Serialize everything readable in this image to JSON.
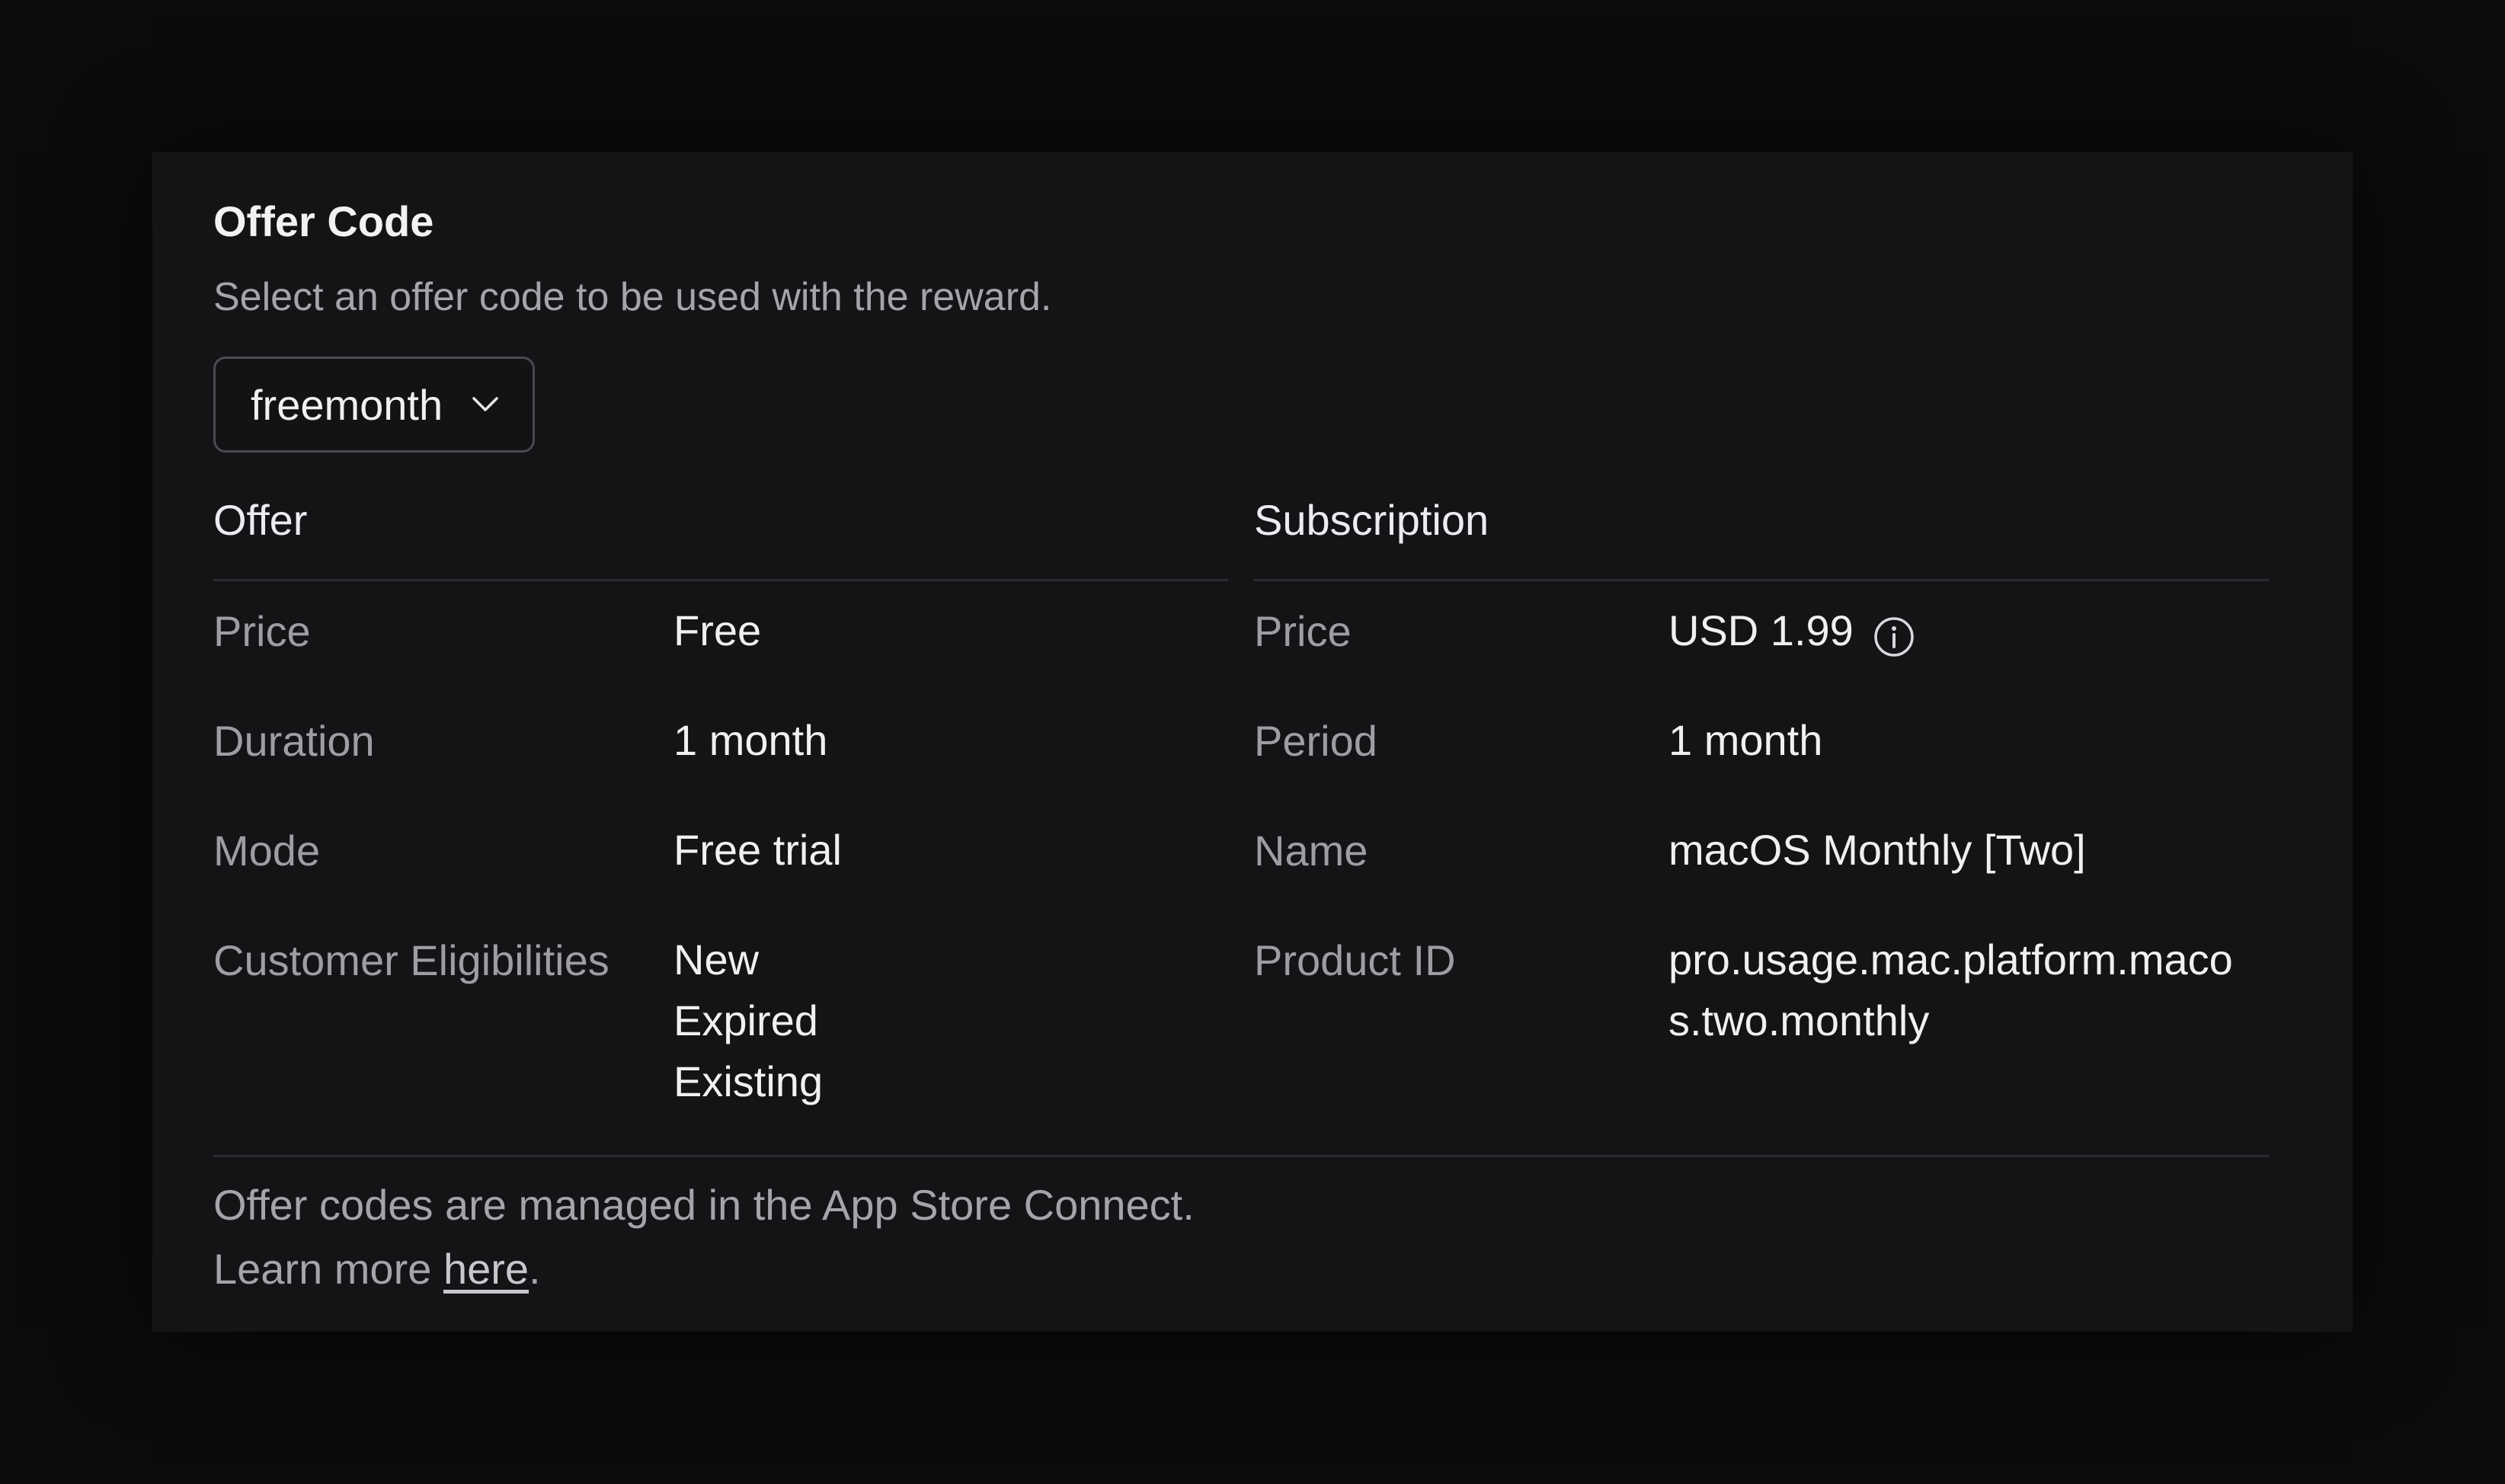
{
  "panel": {
    "title": "Offer Code",
    "subtitle": "Select an offer code to be used with the reward.",
    "offer_code_select": {
      "selected": "freemonth",
      "icon": "chevron-down-icon"
    }
  },
  "offer": {
    "header": "Offer",
    "rows": [
      {
        "label": "Price",
        "value": "Free"
      },
      {
        "label": "Duration",
        "value": "1 month"
      },
      {
        "label": "Mode",
        "value": "Free trial"
      },
      {
        "label": "Customer Eligibilities",
        "values": [
          "New",
          "Expired",
          "Existing"
        ]
      }
    ]
  },
  "subscription": {
    "header": "Subscription",
    "info_icon": "info-icon",
    "rows": [
      {
        "label": "Price",
        "value": "USD 1.99"
      },
      {
        "label": "Period",
        "value": "1 month"
      },
      {
        "label": "Name",
        "value": "macOS Monthly [Two]"
      },
      {
        "label": "Product ID",
        "value_line1": "pro.usage.mac.platform.maco",
        "value_line2": "s.two.monthly"
      }
    ]
  },
  "footer": {
    "line1": "Offer codes are managed in the App Store Connect.",
    "line2_prefix": "Learn more ",
    "link_text": "here",
    "line2_suffix": "."
  },
  "colors": {
    "background": "#0c0c0e",
    "card": "#141416",
    "text_primary": "#f0f0f2",
    "text_secondary": "#9d9da3",
    "divider": "#2c2c30"
  }
}
